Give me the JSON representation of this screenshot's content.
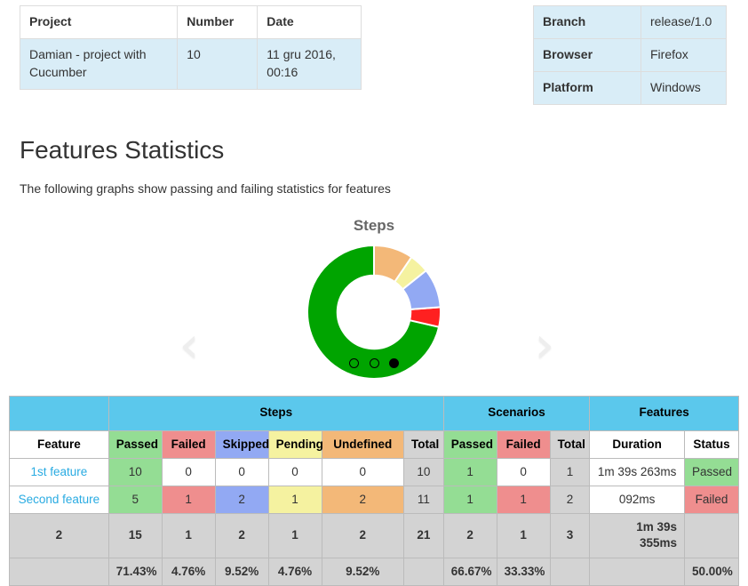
{
  "project_table": {
    "headers": [
      "Project",
      "Number",
      "Date"
    ],
    "row": {
      "project": "Damian - project with Cucumber",
      "number": "10",
      "date": "11 gru 2016, 00:16"
    }
  },
  "env_table": {
    "rows": [
      {
        "label": "Branch",
        "value": "release/1.0"
      },
      {
        "label": "Browser",
        "value": "Firefox"
      },
      {
        "label": "Platform",
        "value": "Windows"
      }
    ]
  },
  "section": {
    "title": "Features Statistics",
    "subtitle": "The following graphs show passing and failing statistics for features"
  },
  "carousel": {
    "prev_icon": "chevron-left",
    "prev_glyph": "‹",
    "next_icon": "chevron-right",
    "next_glyph": "›",
    "dots": [
      {
        "active": false
      },
      {
        "active": false
      },
      {
        "active": true
      }
    ]
  },
  "chart_data": {
    "type": "pie",
    "title": "Steps",
    "variant": "donut",
    "start_angle_deg": -90,
    "direction": "counterclockwise",
    "inner_radius_ratio": 0.55,
    "labels": [
      "Passed",
      "Failed",
      "Skipped",
      "Pending",
      "Undefined"
    ],
    "values": [
      15,
      1,
      2,
      1,
      2
    ],
    "total": 21,
    "percentages": [
      "71.43%",
      "4.76%",
      "9.52%",
      "4.76%",
      "9.52%"
    ],
    "colors": [
      "#00a400",
      "#ff2020",
      "#92a9f3",
      "#f5f2a0",
      "#f3b878"
    ],
    "legend": "none",
    "grid": false
  },
  "stats_table": {
    "group_headers": [
      {
        "label": "",
        "span": 1
      },
      {
        "label": "Steps",
        "span": 6
      },
      {
        "label": "Scenarios",
        "span": 3
      },
      {
        "label": "Features",
        "span": 2
      }
    ],
    "column_headers": [
      {
        "label": "Feature",
        "style": "c-plain"
      },
      {
        "label": "Passed",
        "style": "c-passed"
      },
      {
        "label": "Failed",
        "style": "c-failed"
      },
      {
        "label": "Skipped",
        "style": "c-skipped"
      },
      {
        "label": "Pending",
        "style": "c-pending"
      },
      {
        "label": "Undefined",
        "style": "c-undefined"
      },
      {
        "label": "Total",
        "style": "c-total"
      },
      {
        "label": "Passed",
        "style": "c-passed"
      },
      {
        "label": "Failed",
        "style": "c-failed"
      },
      {
        "label": "Total",
        "style": "c-total"
      },
      {
        "label": "Duration",
        "style": "c-plain"
      },
      {
        "label": "Status",
        "style": "c-plain"
      }
    ],
    "rows": [
      {
        "feature": "1st feature",
        "steps_passed": "10",
        "steps_failed": "0",
        "steps_skipped": "0",
        "steps_pending": "0",
        "steps_undefined": "0",
        "steps_total": "10",
        "scen_passed": "1",
        "scen_failed": "0",
        "scen_total": "1",
        "duration": "1m 39s 263ms",
        "status": "Passed",
        "status_style": "c-passed",
        "cell_styles": {
          "steps_passed": "c-passed",
          "steps_failed": "c-plain",
          "steps_skipped": "c-plain",
          "steps_pending": "c-plain",
          "steps_undefined": "c-plain",
          "steps_total": "c-total",
          "scen_passed": "c-passed",
          "scen_failed": "c-plain",
          "scen_total": "c-total"
        }
      },
      {
        "feature": "Second feature",
        "steps_passed": "5",
        "steps_failed": "1",
        "steps_skipped": "2",
        "steps_pending": "1",
        "steps_undefined": "2",
        "steps_total": "11",
        "scen_passed": "1",
        "scen_failed": "1",
        "scen_total": "2",
        "duration": "092ms",
        "status": "Failed",
        "status_style": "c-failed",
        "cell_styles": {
          "steps_passed": "c-passed",
          "steps_failed": "c-failed",
          "steps_skipped": "c-skipped",
          "steps_pending": "c-pending",
          "steps_undefined": "c-undefined",
          "steps_total": "c-total",
          "scen_passed": "c-passed",
          "scen_failed": "c-failed",
          "scen_total": "c-total"
        }
      }
    ],
    "totals_row": {
      "feature": "2",
      "steps_passed": "15",
      "steps_failed": "1",
      "steps_skipped": "2",
      "steps_pending": "1",
      "steps_undefined": "2",
      "steps_total": "21",
      "scen_passed": "2",
      "scen_failed": "1",
      "scen_total": "3",
      "duration": "1m 39s 355ms",
      "status": ""
    },
    "percent_row": {
      "feature": "",
      "steps_passed": "71.43%",
      "steps_failed": "4.76%",
      "steps_skipped": "9.52%",
      "steps_pending": "4.76%",
      "steps_undefined": "9.52%",
      "steps_total": "",
      "scen_passed": "66.67%",
      "scen_failed": "33.33%",
      "scen_total": "",
      "duration": "",
      "status": "50.00%"
    }
  },
  "colors": {
    "header_band": "#5bc8ec",
    "link": "#29abe2",
    "passed": "#94dd94",
    "failed": "#ef8e8e",
    "skipped": "#92a9f3",
    "pending": "#f5f2a0",
    "undefined": "#f3b878",
    "total": "#d3d3d3",
    "info_row": "#d9edf7",
    "donut_passed": "#00a400",
    "donut_failed": "#ff2020"
  }
}
